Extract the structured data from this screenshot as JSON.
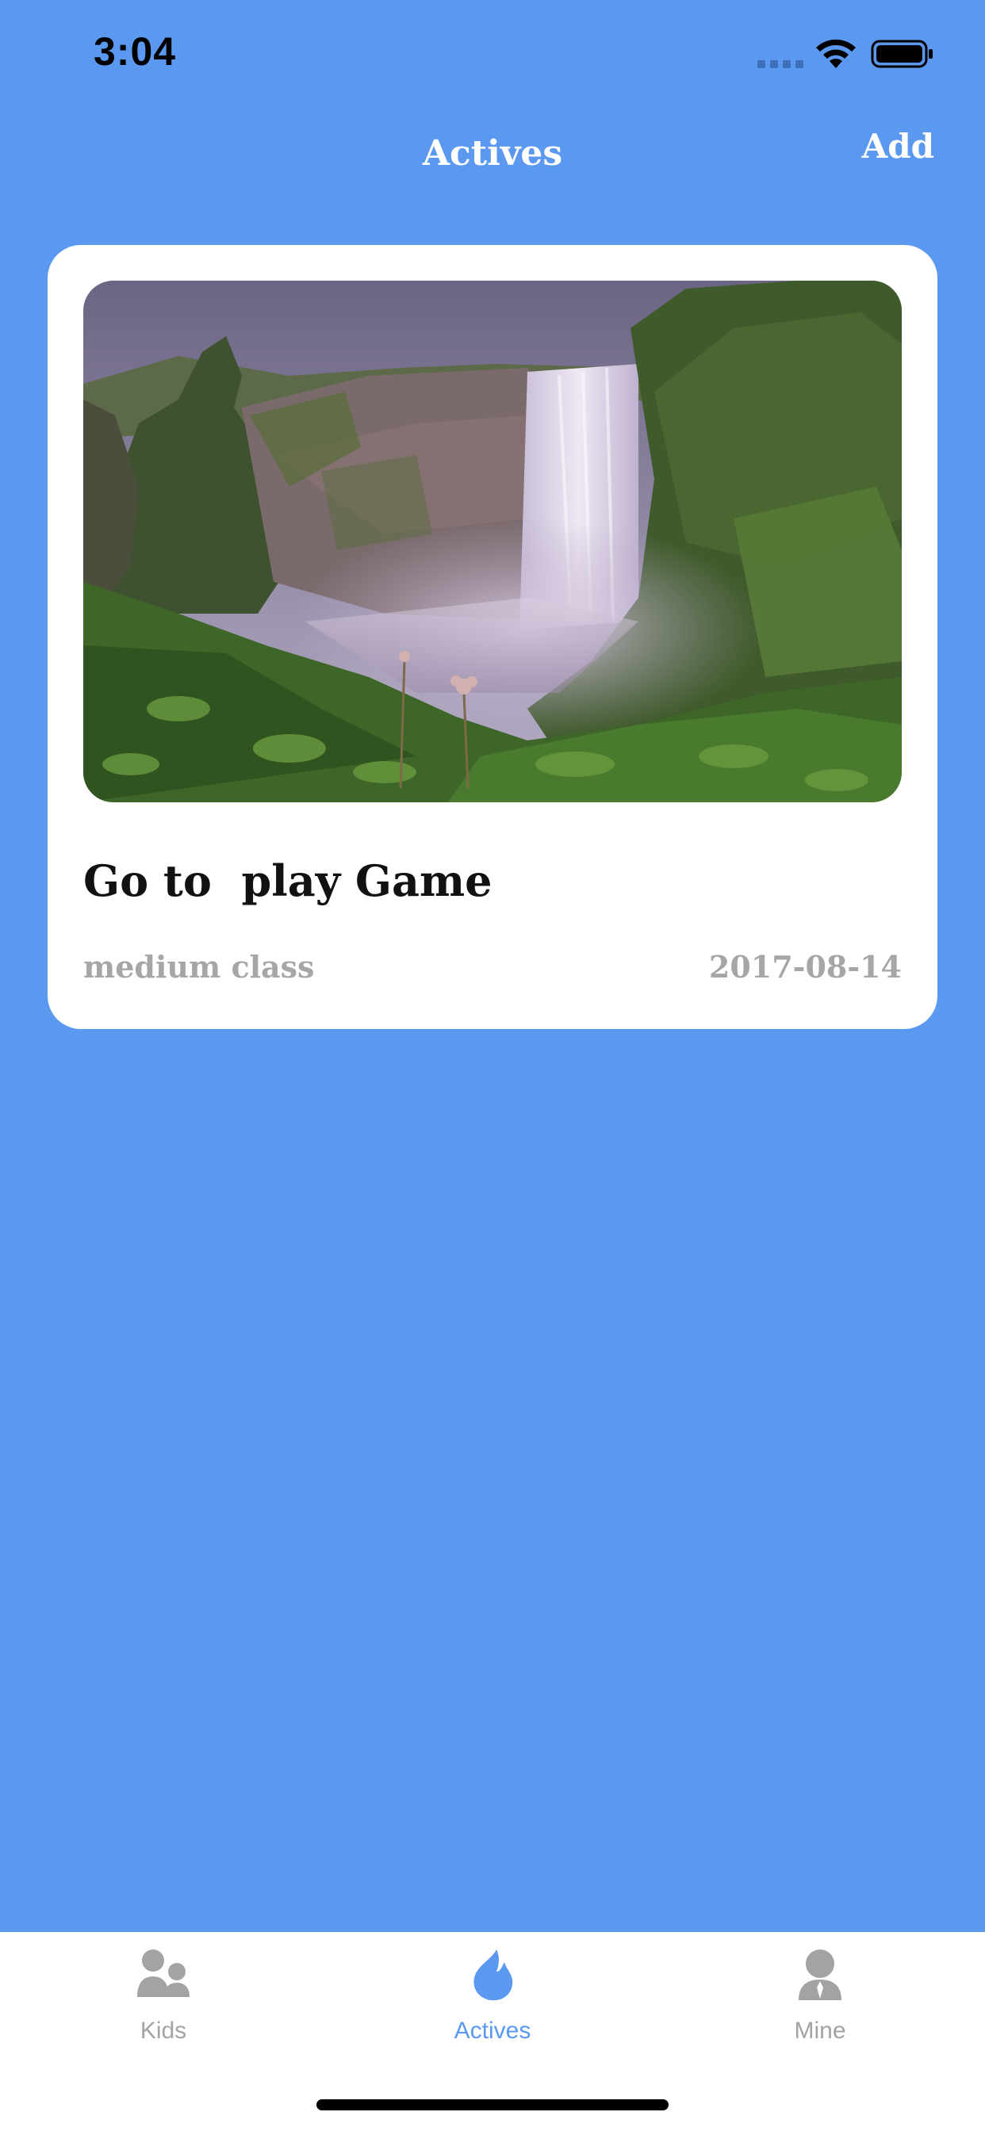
{
  "status_bar": {
    "time": "3:04"
  },
  "nav": {
    "title": "Actives",
    "add_label": "Add"
  },
  "activities": [
    {
      "title": "Go to  play Game",
      "class_name": "medium class",
      "date": "2017-08-14"
    }
  ],
  "tabs": [
    {
      "label": "Kids",
      "icon": "kids-icon",
      "active": false
    },
    {
      "label": "Actives",
      "icon": "flame-icon",
      "active": true
    },
    {
      "label": "Mine",
      "icon": "person-icon",
      "active": false
    }
  ],
  "colors": {
    "background": "#5B99F1",
    "accent": "#5B99F1",
    "tab_inactive": "#A3A3A3",
    "secondary_text": "#A6A6A6"
  }
}
